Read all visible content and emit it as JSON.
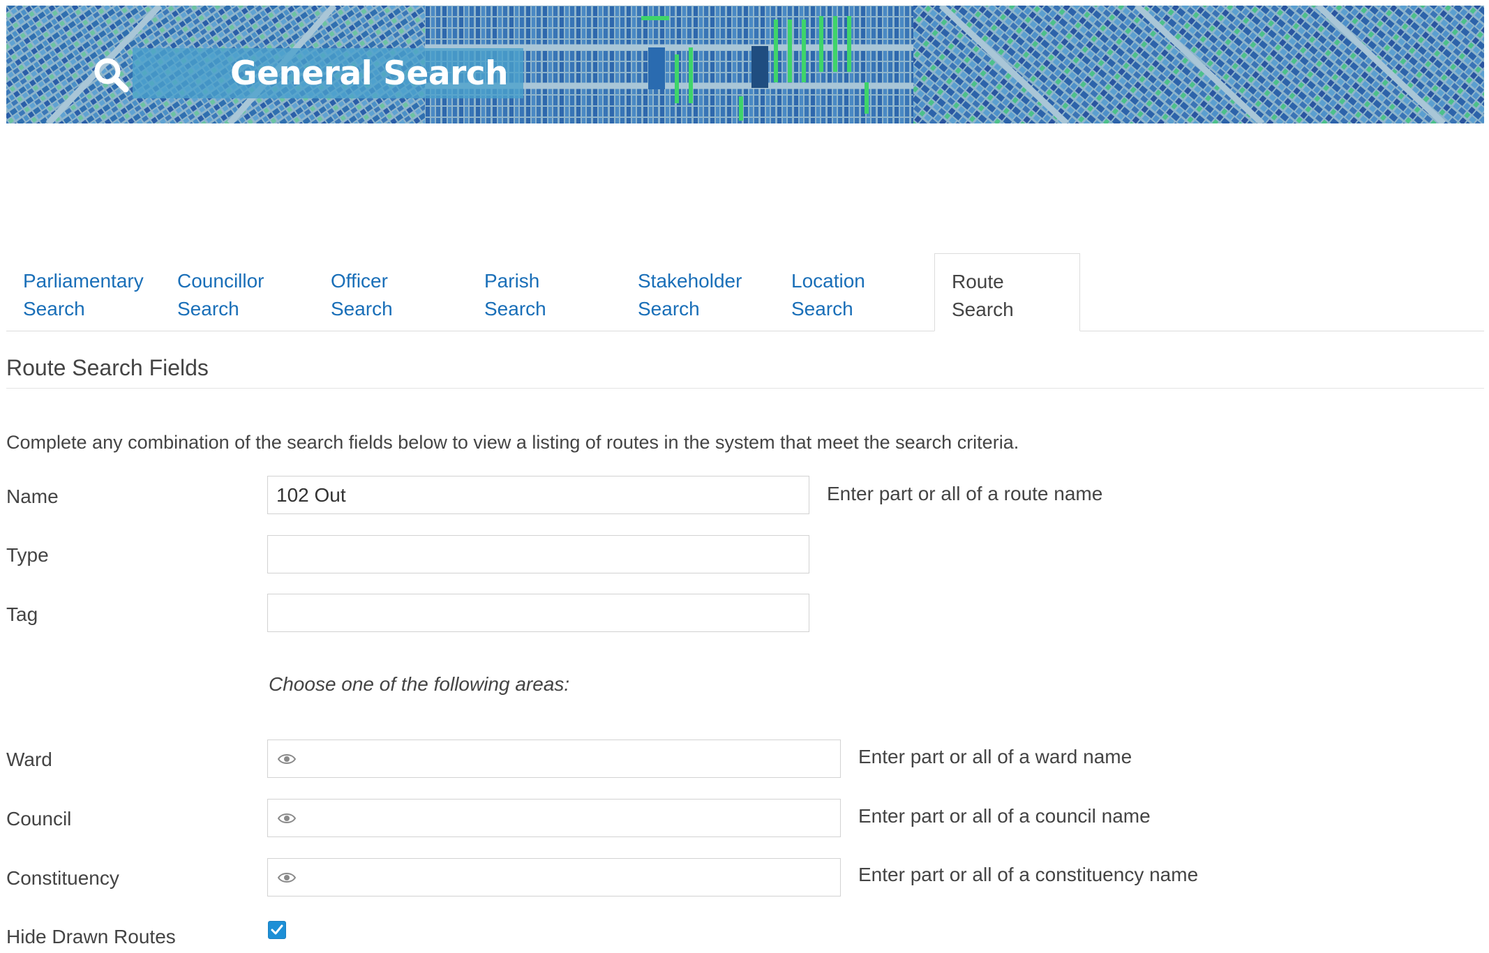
{
  "header": {
    "title": "General Search",
    "icon": "search-icon"
  },
  "tabs": [
    {
      "line1": "Parliamentary",
      "line2": "Search",
      "active": false
    },
    {
      "line1": "Councillor",
      "line2": "Search",
      "active": false
    },
    {
      "line1": "Officer",
      "line2": "Search",
      "active": false
    },
    {
      "line1": "Parish",
      "line2": "Search",
      "active": false
    },
    {
      "line1": "Stakeholder",
      "line2": "Search",
      "active": false
    },
    {
      "line1": "Location",
      "line2": "Search",
      "active": false
    },
    {
      "line1": "Route",
      "line2": "Search",
      "active": true
    }
  ],
  "section": {
    "title": "Route Search Fields",
    "intro": "Complete any combination of the search fields below to view a listing of routes in the system that meet the search criteria."
  },
  "fields": {
    "name": {
      "label": "Name",
      "value": "102 Out",
      "help": "Enter part or all of a route name"
    },
    "type": {
      "label": "Type",
      "value": ""
    },
    "tag": {
      "label": "Tag",
      "value": ""
    },
    "areas_hint": "Choose one of the following areas:",
    "ward": {
      "label": "Ward",
      "value": "",
      "help": "Enter part or all of a ward name"
    },
    "council": {
      "label": "Council",
      "value": "",
      "help": "Enter part or all of a council name"
    },
    "constituency": {
      "label": "Constituency",
      "value": "",
      "help": "Enter part or all of a constituency name"
    },
    "hide_drawn": {
      "label": "Hide Drawn Routes",
      "checked": true
    }
  },
  "colors": {
    "link": "#1a6fb8",
    "accent": "#1d8fd6",
    "banner_overlay": "#4aa0cc"
  }
}
